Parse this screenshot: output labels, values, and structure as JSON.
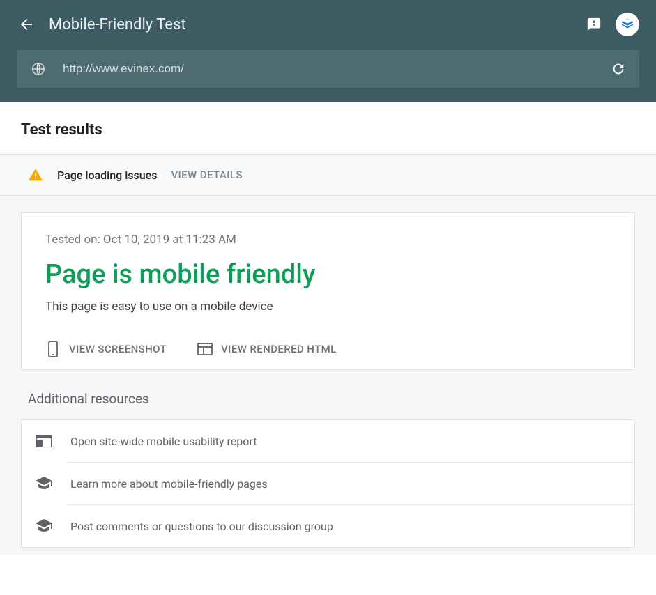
{
  "header": {
    "title": "Mobile-Friendly Test",
    "url": "http://www.evinex.com/"
  },
  "results_heading": "Test results",
  "issues": {
    "text": "Page loading issues",
    "view_details": "VIEW DETAILS"
  },
  "card": {
    "tested_on": "Tested on: Oct 10, 2019 at 11:23 AM",
    "verdict": "Page is mobile friendly",
    "subtext": "This page is easy to use on a mobile device",
    "view_screenshot": "VIEW SCREENSHOT",
    "view_rendered": "VIEW RENDERED HTML"
  },
  "additional": {
    "heading": "Additional resources",
    "items": [
      {
        "icon": "web",
        "label": "Open site-wide mobile usability report"
      },
      {
        "icon": "school",
        "label": "Learn more about mobile-friendly pages"
      },
      {
        "icon": "school",
        "label": "Post comments or questions to our discussion group"
      }
    ]
  },
  "colors": {
    "header_bg": "#3e5c63",
    "verdict_green": "#0f9d58",
    "warning": "#f9ab00"
  }
}
